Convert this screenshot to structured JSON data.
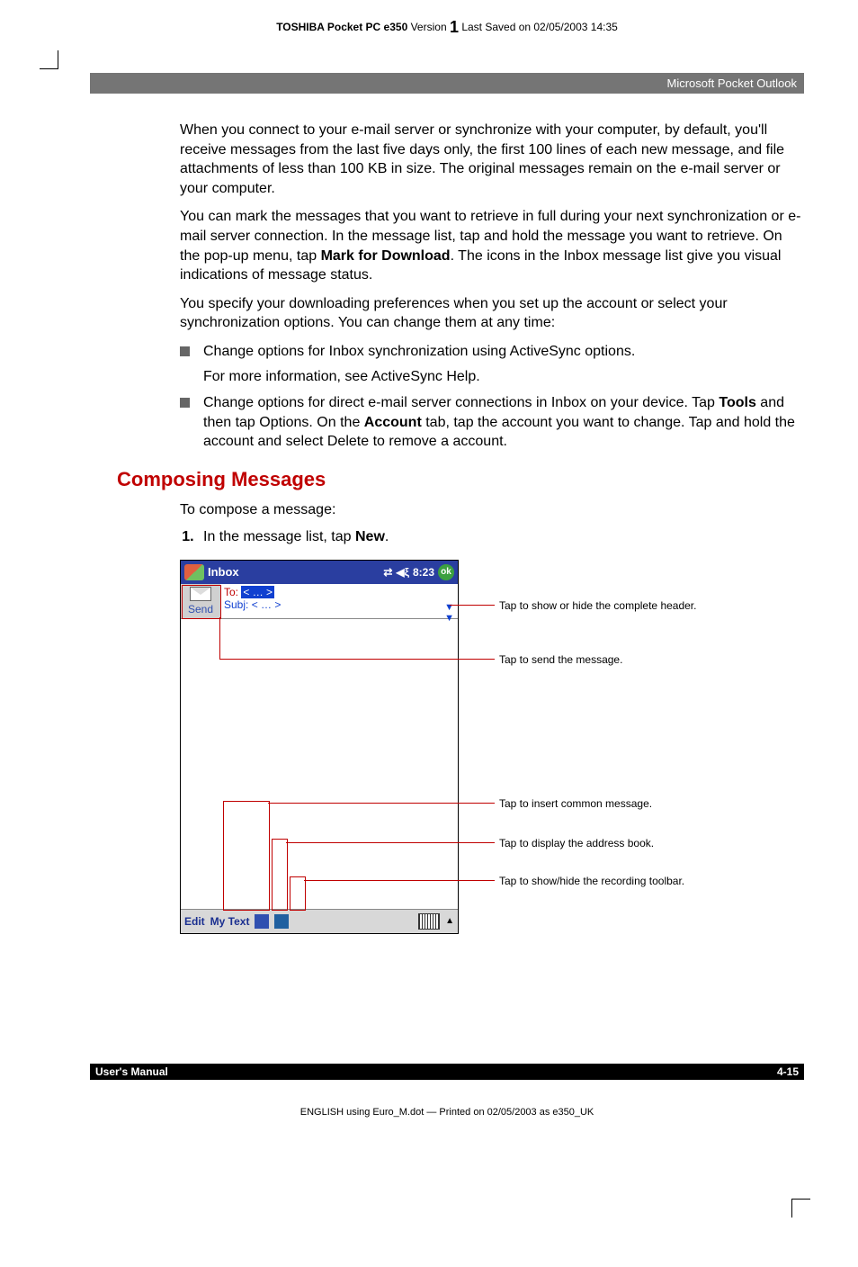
{
  "header": {
    "product": "TOSHIBA Pocket PC e350",
    "version_label": "Version",
    "version_num": "1",
    "saved_label": "Last Saved on 02/05/2003 14:35"
  },
  "chapterHeader": "Microsoft Pocket Outlook",
  "para1": "When you connect to your e-mail server or synchronize with your computer, by default, you'll receive messages from the last five days only, the first 100 lines of each new message, and file attachments of less than 100 KB in size. The original messages remain on the e-mail server or your computer.",
  "para2_a": "You can mark the messages that you want to retrieve in full during your next synchronization or e-mail server connection. In the message list, tap and hold the message you want to retrieve. On the pop-up menu, tap ",
  "para2_bold": "Mark for Download",
  "para2_b": ". The icons in the Inbox message list give you visual indications of message status.",
  "para3": "You specify your downloading preferences when you set up the account or select your synchronization options. You can change them at any time:",
  "bullet1": "Change options for Inbox synchronization using ActiveSync options.",
  "bullet1_sub": "For more information, see ActiveSync Help.",
  "bullet2_a": "Change options for direct e-mail server connections in Inbox on your device. Tap ",
  "bullet2_bold1": "Tools",
  "bullet2_b": " and then tap Options. On the ",
  "bullet2_bold2": "Account",
  "bullet2_c": " tab, tap the account you want to change. Tap and hold the account and select Delete to remove a account.",
  "heading": "Composing Messages",
  "intro": "To compose a message:",
  "step1_a": "In the message list, tap ",
  "step1_bold": "New",
  "step1_b": ".",
  "titlebar": {
    "title": "Inbox",
    "time": "8:23",
    "ok": "ok"
  },
  "compose": {
    "send": "Send",
    "to_label": "To:",
    "to_value": "< … >",
    "subj_label": "Subj:",
    "subj_value": "< … >"
  },
  "editbar": {
    "edit": "Edit",
    "mytext": "My Text"
  },
  "callouts": {
    "c1": "Tap to show or hide the complete header.",
    "c2": "Tap to send the message.",
    "c3": "Tap to insert common message.",
    "c4": "Tap to display the address book.",
    "c5": "Tap to show/hide the recording toolbar."
  },
  "footer": {
    "left": "User's Manual",
    "right": "4-15"
  },
  "footnote": "ENGLISH using Euro_M.dot — Printed on 02/05/2003 as e350_UK"
}
